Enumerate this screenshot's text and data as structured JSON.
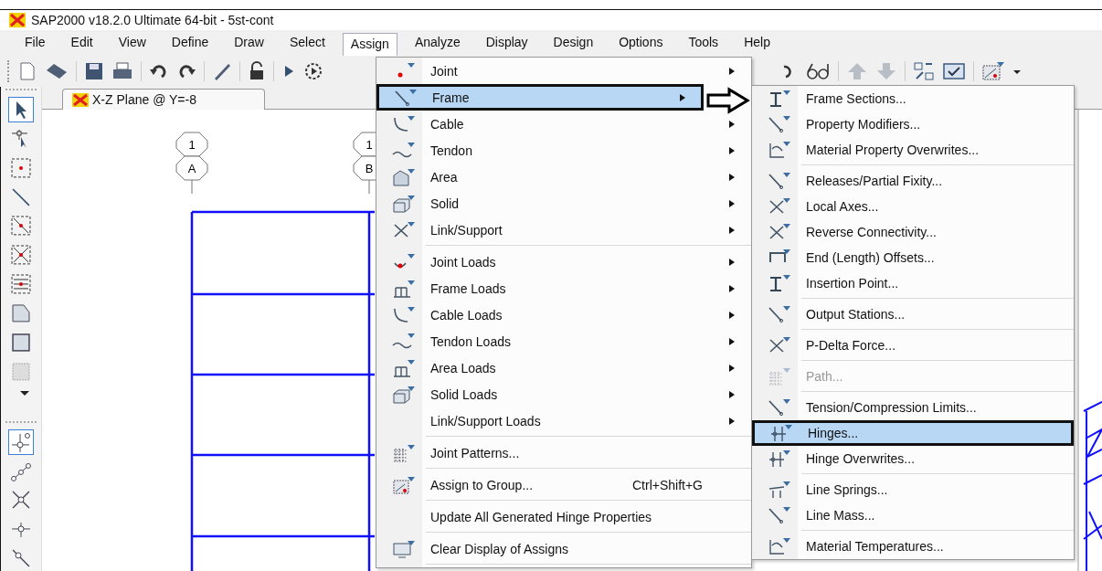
{
  "window": {
    "title": "SAP2000 v18.2.0 Ultimate 64-bit - 5st-cont"
  },
  "menu_bar": [
    {
      "label": "File",
      "selected": false
    },
    {
      "label": "Edit",
      "selected": false
    },
    {
      "label": "View",
      "selected": false
    },
    {
      "label": "Define",
      "selected": false
    },
    {
      "label": "Draw",
      "selected": false
    },
    {
      "label": "Select",
      "selected": false
    },
    {
      "label": "Assign",
      "selected": true
    },
    {
      "label": "Analyze",
      "selected": false
    },
    {
      "label": "Display",
      "selected": false
    },
    {
      "label": "Design",
      "selected": false
    },
    {
      "label": "Options",
      "selected": false
    },
    {
      "label": "Tools",
      "selected": false
    },
    {
      "label": "Help",
      "selected": false
    }
  ],
  "view_tab": {
    "title": "X-Z Plane @ Y=-8"
  },
  "grid_bubbles": [
    {
      "label": "1"
    },
    {
      "label": "A"
    },
    {
      "label": "1"
    },
    {
      "label": "B"
    }
  ],
  "assign_menu": {
    "items": [
      {
        "kind": "item",
        "label": "Joint",
        "submenu": true,
        "selected": false
      },
      {
        "kind": "item",
        "label": "Frame",
        "submenu": true,
        "selected": true
      },
      {
        "kind": "item",
        "label": "Cable",
        "submenu": true,
        "selected": false
      },
      {
        "kind": "item",
        "label": "Tendon",
        "submenu": true,
        "selected": false
      },
      {
        "kind": "item",
        "label": "Area",
        "submenu": true,
        "selected": false
      },
      {
        "kind": "item",
        "label": "Solid",
        "submenu": true,
        "selected": false
      },
      {
        "kind": "item",
        "label": "Link/Support",
        "submenu": true,
        "selected": false
      },
      {
        "kind": "separator"
      },
      {
        "kind": "item",
        "label": "Joint Loads",
        "submenu": true,
        "selected": false
      },
      {
        "kind": "item",
        "label": "Frame Loads",
        "submenu": true,
        "selected": false
      },
      {
        "kind": "item",
        "label": "Cable Loads",
        "submenu": true,
        "selected": false
      },
      {
        "kind": "item",
        "label": "Tendon Loads",
        "submenu": true,
        "selected": false
      },
      {
        "kind": "item",
        "label": "Area Loads",
        "submenu": true,
        "selected": false
      },
      {
        "kind": "item",
        "label": "Solid Loads",
        "submenu": true,
        "selected": false
      },
      {
        "kind": "item",
        "label": "Link/Support Loads",
        "submenu": true,
        "selected": false
      },
      {
        "kind": "separator"
      },
      {
        "kind": "item",
        "label": "Joint Patterns...",
        "submenu": false,
        "selected": false
      },
      {
        "kind": "separator"
      },
      {
        "kind": "item",
        "label": "Assign to Group...",
        "shortcut": "Ctrl+Shift+G",
        "submenu": false,
        "selected": false
      },
      {
        "kind": "separator"
      },
      {
        "kind": "item",
        "label": "Update All Generated Hinge Properties",
        "submenu": false,
        "selected": false
      },
      {
        "kind": "separator"
      },
      {
        "kind": "item",
        "label": "Clear Display of Assigns",
        "submenu": false,
        "selected": false
      },
      {
        "kind": "separator"
      }
    ]
  },
  "frame_submenu": {
    "items": [
      {
        "kind": "item",
        "label": "Frame Sections...",
        "selected": false,
        "disabled": false
      },
      {
        "kind": "item",
        "label": "Property Modifiers...",
        "selected": false,
        "disabled": false
      },
      {
        "kind": "item",
        "label": "Material Property Overwrites...",
        "selected": false,
        "disabled": false
      },
      {
        "kind": "separator"
      },
      {
        "kind": "item",
        "label": "Releases/Partial Fixity...",
        "selected": false,
        "disabled": false
      },
      {
        "kind": "item",
        "label": "Local Axes...",
        "selected": false,
        "disabled": false
      },
      {
        "kind": "item",
        "label": "Reverse Connectivity...",
        "selected": false,
        "disabled": false
      },
      {
        "kind": "item",
        "label": "End (Length) Offsets...",
        "selected": false,
        "disabled": false
      },
      {
        "kind": "item",
        "label": "Insertion Point...",
        "selected": false,
        "disabled": false
      },
      {
        "kind": "separator"
      },
      {
        "kind": "item",
        "label": "Output Stations...",
        "selected": false,
        "disabled": false
      },
      {
        "kind": "separator"
      },
      {
        "kind": "item",
        "label": "P-Delta Force...",
        "selected": false,
        "disabled": false
      },
      {
        "kind": "separator"
      },
      {
        "kind": "item",
        "label": "Path...",
        "selected": false,
        "disabled": true
      },
      {
        "kind": "separator"
      },
      {
        "kind": "item",
        "label": "Tension/Compression Limits...",
        "selected": false,
        "disabled": false
      },
      {
        "kind": "item",
        "label": "Hinges...",
        "selected": true,
        "disabled": false
      },
      {
        "kind": "item",
        "label": "Hinge Overwrites...",
        "selected": false,
        "disabled": false
      },
      {
        "kind": "separator"
      },
      {
        "kind": "item",
        "label": "Line Springs...",
        "selected": false,
        "disabled": false
      },
      {
        "kind": "item",
        "label": "Line Mass...",
        "selected": false,
        "disabled": false
      },
      {
        "kind": "separator"
      },
      {
        "kind": "item",
        "label": "Material Temperatures...",
        "selected": false,
        "disabled": false
      }
    ]
  }
}
